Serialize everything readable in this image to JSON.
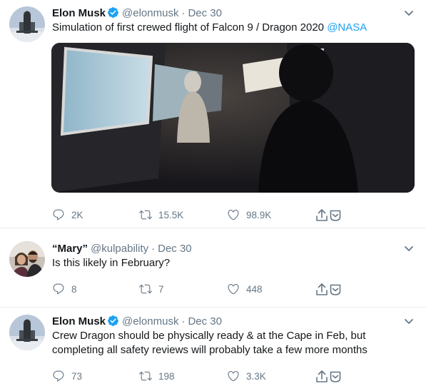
{
  "colors": {
    "accent": "#1da1f2",
    "muted": "#657786",
    "border": "#e6ecf0",
    "text": "#14171a"
  },
  "tweets": [
    {
      "name": "Elon Musk",
      "verified": true,
      "handle": "@elonmusk",
      "separator": "·",
      "date": "Dec 30",
      "text_plain": "Simulation of first crewed flight of Falcon 9 / Dragon 2020 ",
      "mention": "@NASA",
      "has_media": true,
      "replies": "2K",
      "retweets": "15.5K",
      "likes": "98.9K",
      "icons": [
        "reply-icon",
        "retweet-icon",
        "like-icon",
        "share-icon"
      ]
    },
    {
      "name": "“Mary”",
      "verified": false,
      "handle": "@kulpability",
      "separator": "·",
      "date": "Dec 30",
      "text_plain": "Is this likely in February?",
      "replies": "8",
      "retweets": "7",
      "likes": "448"
    },
    {
      "name": "Elon Musk",
      "verified": true,
      "handle": "@elonmusk",
      "separator": "·",
      "date": "Dec 30",
      "text_line1": "Crew Dragon should be physically ready & at the Cape in Feb, but",
      "text_line2": "completing all safety reviews will probably take a few more months",
      "replies": "73",
      "retweets": "198",
      "likes": "3.3K"
    }
  ]
}
